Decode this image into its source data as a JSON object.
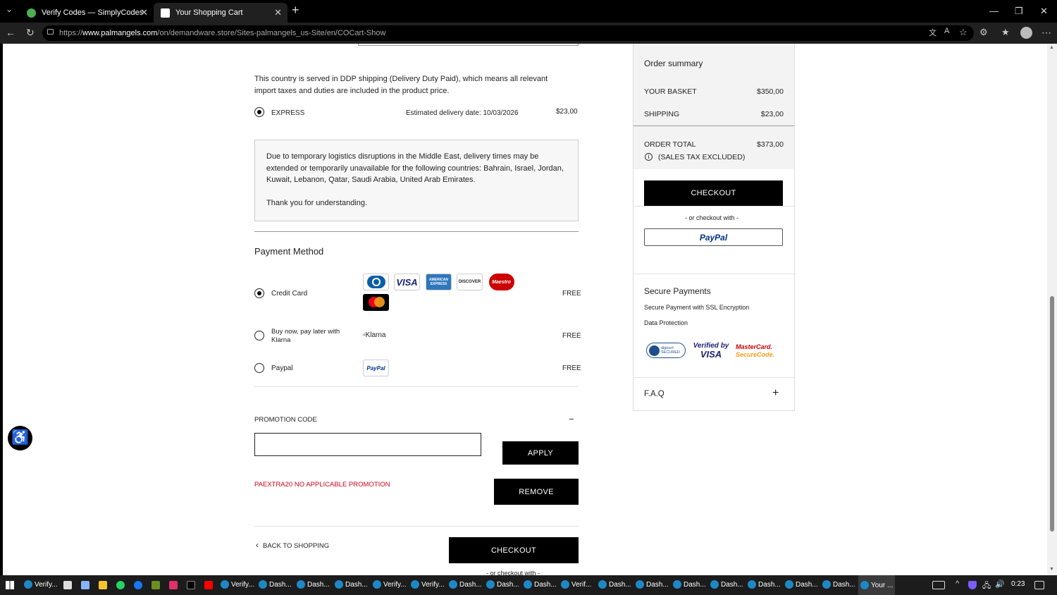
{
  "browser": {
    "tabs": [
      {
        "label": "Verify Codes — SimplyCodes",
        "active": false
      },
      {
        "label": "Your Shopping Cart",
        "active": true
      }
    ],
    "url_prefix": "https://",
    "url_domain": "www.palmangels.com",
    "url_path": "/on/demandware.store/Sites-palmangels_us-Site/en/COCart-Show"
  },
  "shipping": {
    "ddp_note_line1": "This country is served in DDP shipping (Delivery Duty Paid), which means all relevant",
    "ddp_note_line2": "import taxes and duties are included in the product price.",
    "option_label": "EXPRESS",
    "estimate": "Estimated delivery date: 10/03/2026",
    "price": "$23,00",
    "notice_line1": "Due to temporary logistics disruptions in the Middle East, delivery times may be",
    "notice_line2": "extended or temporarily unavailable for the following countries: Bahrain, Israel, Jordan,",
    "notice_line3": "Kuwait, Lebanon, Qatar, Saudi Arabia, United Arab Emirates.",
    "notice_thanks": "Thank you for understanding."
  },
  "payment": {
    "heading": "Payment Method",
    "methods": [
      {
        "label": "Credit Card",
        "price": "FREE",
        "selected": true
      },
      {
        "label_line1": "Buy now, pay later with",
        "label_line2": "Klarna",
        "logo_alt": "Klarna",
        "price": "FREE",
        "selected": false
      },
      {
        "label": "Paypal",
        "price": "FREE",
        "selected": false
      }
    ],
    "card_logos": [
      "Diners",
      "VISA",
      "AMERICAN EXPRESS",
      "DISCOVER",
      "Maestro",
      "mastercard"
    ]
  },
  "promo": {
    "heading": "PROMOTION CODE",
    "toggle": "−",
    "input_value": "",
    "apply_label": "APPLY",
    "error": "PAEXTRA20 NO APPLICABLE PROMOTION",
    "remove_label": "REMOVE"
  },
  "footer": {
    "back_label": "BACK TO SHOPPING",
    "checkout_label": "CHECKOUT",
    "or_checkout": "- or checkout with -"
  },
  "summary": {
    "title": "Order summary",
    "basket_label": "YOUR BASKET",
    "basket_value": "$350,00",
    "shipping_label": "SHIPPING",
    "shipping_value": "$23,00",
    "total_label": "ORDER TOTAL",
    "total_value": "$373,00",
    "tax_note": "(SALES TAX EXCLUDED)",
    "checkout_label": "CHECKOUT",
    "or_checkout": "- or checkout with -",
    "paypal_label": "PayPal",
    "secure_title": "Secure Payments",
    "secure_line1": "Secure Payment with SSL Encryption",
    "secure_line2": "Data Protection",
    "badge_digicert": "digicert SECURED",
    "badge_visa_line1": "Verified by",
    "badge_visa_line2": "VISA",
    "badge_mc_line1": "MasterCard.",
    "badge_mc_line2": "SecureCode.",
    "faq_label": "F.A.Q",
    "faq_toggle": "+"
  },
  "taskbar": {
    "items": [
      "Verify...",
      "Verify...",
      "Dash...",
      "Dash...",
      "Dash...",
      "Verify...",
      "Verify...",
      "Dash...",
      "Dash...",
      "Dash...",
      "Verif...",
      "Dash...",
      "Dash...",
      "Dash...",
      "Dash...",
      "Dash...",
      "Dash...",
      "Dash...",
      "Your ..."
    ],
    "clock": "0:23"
  },
  "colors": {
    "accent": "#000000",
    "error": "#d0021b",
    "summary_bg": "#f3f3f3"
  }
}
